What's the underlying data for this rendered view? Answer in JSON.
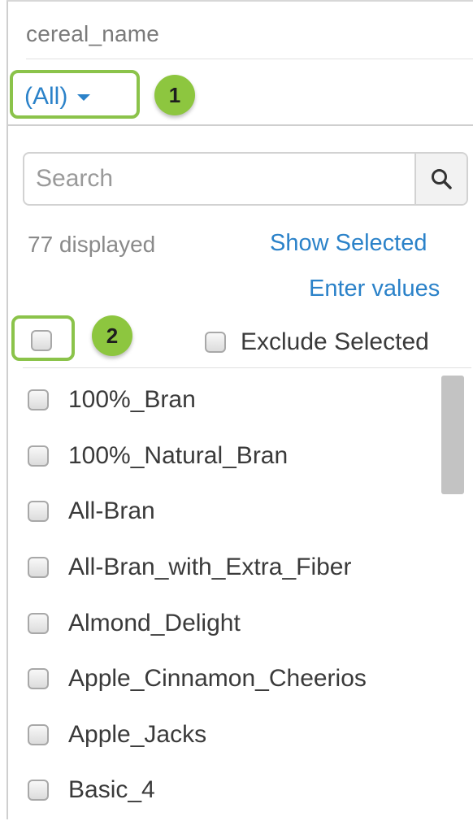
{
  "filter": {
    "field_name": "cereal_name",
    "dropdown_value": "(All)",
    "search_placeholder": "Search",
    "count_text": "77 displayed",
    "show_selected_label": "Show Selected",
    "enter_values_label": "Enter values",
    "exclude_selected_label": "Exclude Selected"
  },
  "annotations": {
    "badge_1": "1",
    "badge_2": "2",
    "color": "#8dc63f"
  },
  "icons": {
    "search": "search-icon",
    "dropdown": "caret-down-icon"
  },
  "colors": {
    "link": "#2b82c9",
    "text": "#3a3a3a",
    "muted": "#8a8a8a"
  },
  "items": [
    {
      "label": "100%_Bran",
      "checked": false
    },
    {
      "label": "100%_Natural_Bran",
      "checked": false
    },
    {
      "label": "All-Bran",
      "checked": false
    },
    {
      "label": "All-Bran_with_Extra_Fiber",
      "checked": false
    },
    {
      "label": "Almond_Delight",
      "checked": false
    },
    {
      "label": "Apple_Cinnamon_Cheerios",
      "checked": false
    },
    {
      "label": "Apple_Jacks",
      "checked": false
    },
    {
      "label": "Basic_4",
      "checked": false
    }
  ]
}
